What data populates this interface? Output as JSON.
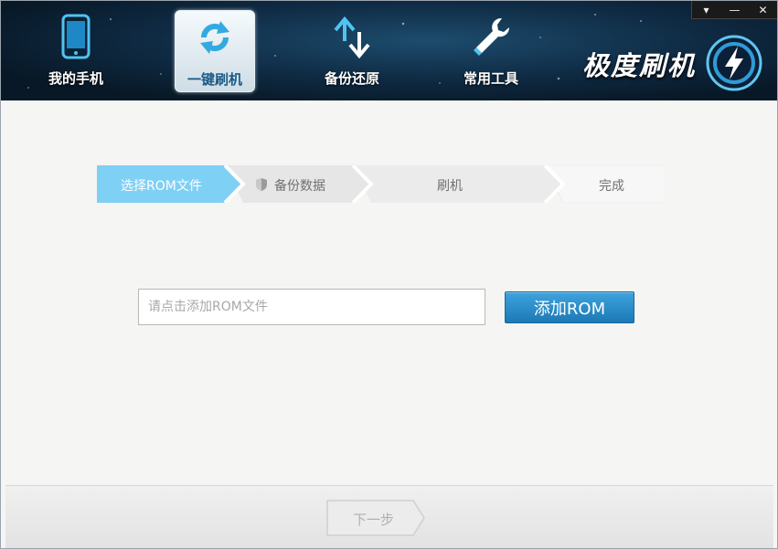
{
  "nav": {
    "items": [
      {
        "label": "我的手机",
        "icon": "phone-icon"
      },
      {
        "label": "一键刷机",
        "icon": "refresh-icon",
        "active": true
      },
      {
        "label": "备份还原",
        "icon": "backup-restore-icon"
      },
      {
        "label": "常用工具",
        "icon": "wrench-icon"
      }
    ]
  },
  "brand": {
    "title": "极度刷机"
  },
  "window_controls": {
    "menu": "▾",
    "minimize": "—",
    "close": "✕"
  },
  "steps": [
    {
      "label": "选择ROM文件",
      "active": true
    },
    {
      "label": "备份数据",
      "icon": "shield-icon"
    },
    {
      "label": "刷机"
    },
    {
      "label": "完成"
    }
  ],
  "rom": {
    "placeholder": "请点击添加ROM文件",
    "button_label": "添加ROM"
  },
  "footer": {
    "next_label": "下一步"
  },
  "colors": {
    "accent": "#2a8fcf",
    "step_active": "#7fd0f5",
    "header_bg": "#0f2b44"
  }
}
